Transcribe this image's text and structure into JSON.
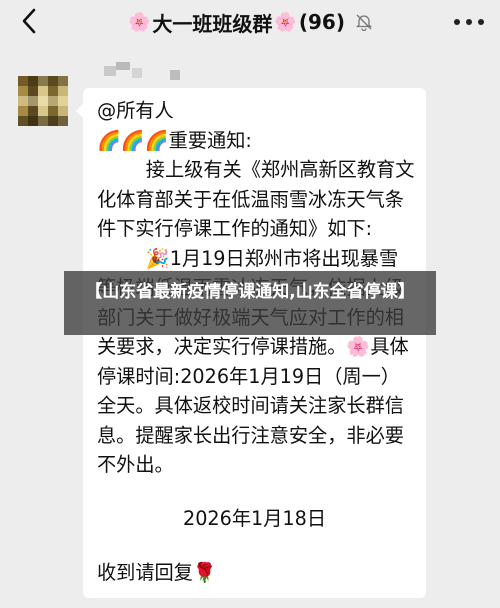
{
  "header": {
    "title_prefix_emoji": "🌸",
    "title": "大一班班级群",
    "title_suffix_emoji": "🌸",
    "member_count": "(96)",
    "icons": [
      "back-chevron-icon",
      "mute-bell-icon",
      "more-dots-icon"
    ]
  },
  "message": {
    "text": "@所有人\n🌈🌈🌈重要通知:\n        接上级有关《郑州高新区教育文化体育部关于在低温雨雪冰冻天气条件下实行停课工作的通知》如下:\n        🎉1月19日郑州市将出现暴雪等极端低温雨雪冰冻天气，依据上级部门关于做好极端天气应对工作的相关要求，决定实行停课措施。🌸具体停课时间:2026年1月19日（周一）全天。具体返校时间请关注家长群信息。提醒家长出行注意安全，非必要不外出。",
    "date_signature": "2026年1月18日",
    "reply_line": "收到请回复🌹"
  },
  "overlay": {
    "caption": "【山东省最新疫情停课通知,山东全省停课】"
  },
  "colors": {
    "background": "#ededed",
    "bubble": "#ffffff",
    "overlay": "#3c3c3c"
  }
}
